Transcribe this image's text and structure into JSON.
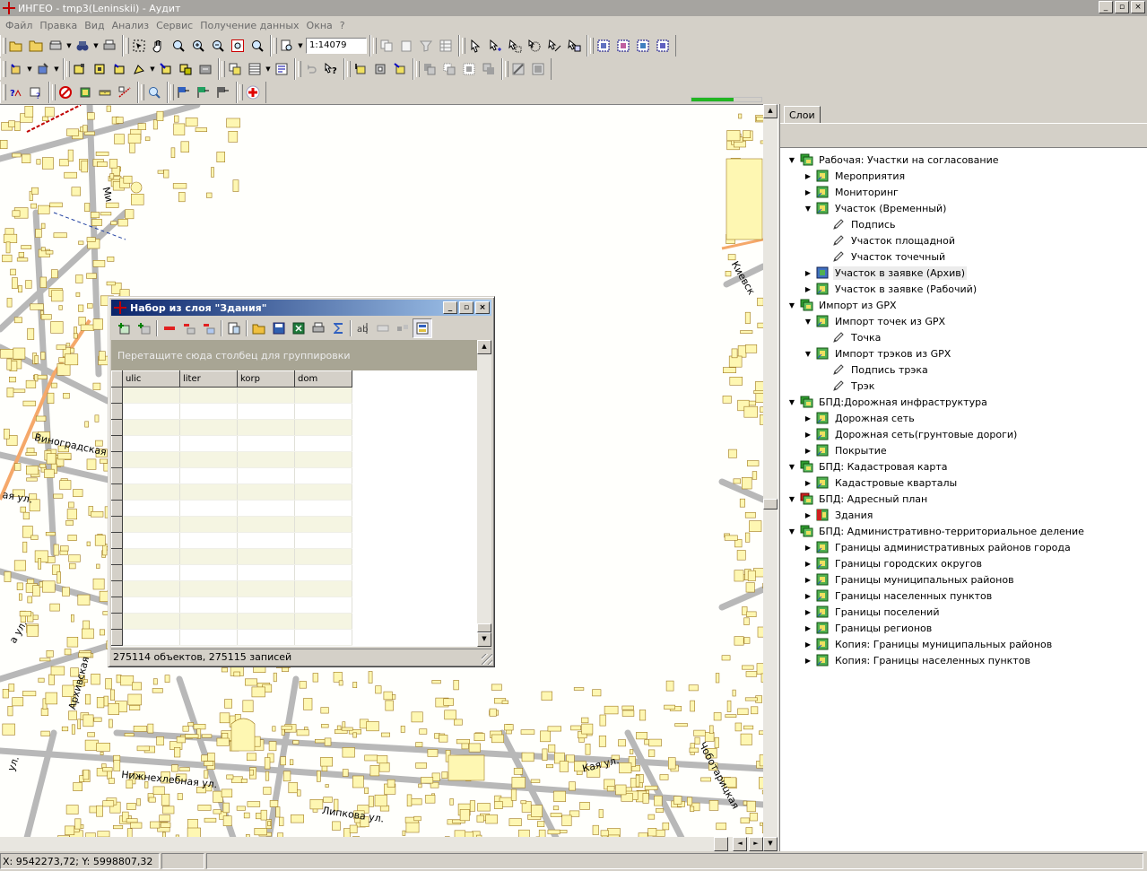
{
  "window": {
    "title": "ИНГЕО - tmp3(Leninskii) - Аудит",
    "controls": {
      "minimize": "_",
      "maximize": "▫",
      "close": "×"
    }
  },
  "menu": [
    "Файл",
    "Правка",
    "Вид",
    "Анализ",
    "Сервис",
    "Получение данных",
    "Окна",
    "?"
  ],
  "toolbar": {
    "scale": "1:14079",
    "progress_fraction": 0.6
  },
  "colors": {
    "building_fill": "#fef7b2",
    "building_stroke": "#a07a20",
    "road": "#b8b8b8",
    "major_road": "#f5a86a",
    "dialog_title_start": "#0a246a",
    "dialog_title_end": "#a6caf0",
    "progress": "#22b522"
  },
  "map": {
    "labels": [
      "Ми",
      "Виноградская",
      "Киевск",
      "ая ул.",
      "а ул.",
      "Нижнехлебная ул.",
      "Липкова ул.",
      "Кая ул.",
      "Чоботарицкая",
      "Архивская",
      "ул."
    ]
  },
  "layers_panel": {
    "tab": "Слои",
    "tree": [
      {
        "label": "Рабочая: Участки на согласование",
        "level": 0,
        "expanded": true,
        "icon": "layer-group-icon"
      },
      {
        "label": "Мероприятия",
        "level": 1,
        "expanded": false,
        "icon": "layer-icon"
      },
      {
        "label": "Мониторинг",
        "level": 1,
        "expanded": false,
        "icon": "layer-icon"
      },
      {
        "label": "Участок (Временный)",
        "level": 1,
        "expanded": true,
        "icon": "layer-icon"
      },
      {
        "label": "Подпись",
        "level": 2,
        "icon": "pencil-icon"
      },
      {
        "label": "Участок площадной",
        "level": 2,
        "icon": "pencil-icon"
      },
      {
        "label": "Участок точечный",
        "level": 2,
        "icon": "pencil-icon"
      },
      {
        "label": "Участок в заявке (Архив)",
        "level": 1,
        "expanded": false,
        "icon": "layer-blue-icon",
        "highlight": true
      },
      {
        "label": "Участок в заявке (Рабочий)",
        "level": 1,
        "expanded": false,
        "icon": "layer-icon"
      },
      {
        "label": "Импорт из GPX",
        "level": 0,
        "expanded": true,
        "icon": "layer-group-icon"
      },
      {
        "label": "Импорт точек из GPX",
        "level": 1,
        "expanded": true,
        "icon": "layer-icon"
      },
      {
        "label": "Точка",
        "level": 2,
        "icon": "pencil-icon"
      },
      {
        "label": "Импорт трэков из GPX",
        "level": 1,
        "expanded": true,
        "icon": "layer-icon"
      },
      {
        "label": "Подпись трэка",
        "level": 2,
        "icon": "pencil-icon"
      },
      {
        "label": "Трэк",
        "level": 2,
        "icon": "pencil-icon"
      },
      {
        "label": "БПД:Дорожная инфраструктура",
        "level": 0,
        "expanded": true,
        "icon": "layer-group-icon"
      },
      {
        "label": "Дорожная сеть",
        "level": 1,
        "expanded": false,
        "icon": "layer-icon"
      },
      {
        "label": "Дорожная сеть(грунтовые дороги)",
        "level": 1,
        "expanded": false,
        "icon": "layer-icon"
      },
      {
        "label": "Покрытие",
        "level": 1,
        "expanded": false,
        "icon": "layer-icon"
      },
      {
        "label": "БПД: Кадастровая карта",
        "level": 0,
        "expanded": true,
        "icon": "layer-group-icon"
      },
      {
        "label": "Кадастровые кварталы",
        "level": 1,
        "expanded": false,
        "icon": "layer-icon"
      },
      {
        "label": "БПД: Адресный план",
        "level": 0,
        "expanded": true,
        "icon": "layer-group-red-icon"
      },
      {
        "label": "Здания",
        "level": 1,
        "expanded": false,
        "icon": "layer-red-icon"
      },
      {
        "label": "БПД: Административно-территориальное деление",
        "level": 0,
        "expanded": true,
        "icon": "layer-group-icon"
      },
      {
        "label": "Границы административных районов города",
        "level": 1,
        "expanded": false,
        "icon": "layer-icon"
      },
      {
        "label": "Границы городских округов",
        "level": 1,
        "expanded": false,
        "icon": "layer-icon"
      },
      {
        "label": "Границы муниципальных районов",
        "level": 1,
        "expanded": false,
        "icon": "layer-icon"
      },
      {
        "label": "Границы населенных пунктов",
        "level": 1,
        "expanded": false,
        "icon": "layer-icon"
      },
      {
        "label": "Границы поселений",
        "level": 1,
        "expanded": false,
        "icon": "layer-icon"
      },
      {
        "label": "Границы регионов",
        "level": 1,
        "expanded": false,
        "icon": "layer-icon"
      },
      {
        "label": "Копия: Границы муниципальных районов",
        "level": 1,
        "expanded": false,
        "icon": "layer-icon"
      },
      {
        "label": "Копия: Границы населенных пунктов",
        "level": 1,
        "expanded": false,
        "icon": "layer-icon"
      }
    ]
  },
  "dialog": {
    "title": "Набор из слоя \"Здания\"",
    "group_hint": "Перетащите сюда столбец для группировки",
    "columns": [
      "ulic",
      "liter",
      "korp",
      "dom"
    ],
    "row_count": 16,
    "status": "275114 объектов, 275115 записей"
  },
  "statusbar": {
    "coords": "X: 9542273,72; Y: 5998807,32"
  }
}
